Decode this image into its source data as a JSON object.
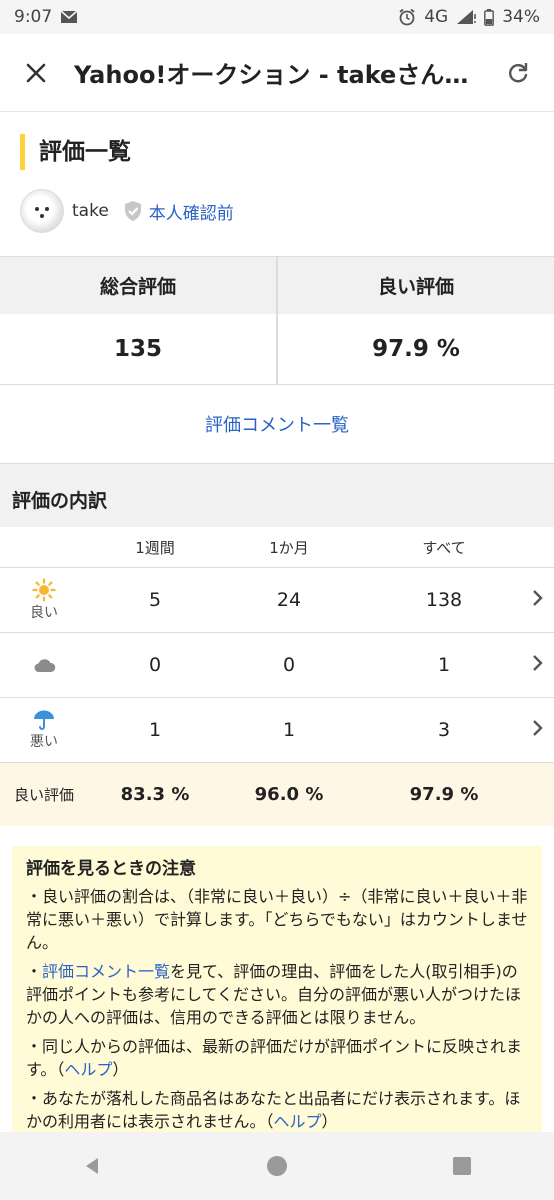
{
  "status": {
    "time": "9:07",
    "network": "4G",
    "battery": "34%"
  },
  "appbar": {
    "title": "Yahoo!オークション - takeさんの…"
  },
  "page": {
    "section_title": "評価一覧"
  },
  "user": {
    "name": "take",
    "verify_label": "本人確認前"
  },
  "summary": {
    "total_label": "総合評価",
    "total_value": "135",
    "good_label": "良い評価",
    "good_value": "97.9 %"
  },
  "comment_link": "評価コメント一覧",
  "breakdown": {
    "title": "評価の内訳",
    "headers": [
      "1週間",
      "1か月",
      "すべて"
    ],
    "rows": [
      {
        "label": "良い",
        "icon": "sun-icon",
        "values": [
          "5",
          "24",
          "138"
        ]
      },
      {
        "label": "",
        "icon": "cloud-icon",
        "values": [
          "0",
          "0",
          "1"
        ]
      },
      {
        "label": "悪い",
        "icon": "umbrella-icon",
        "values": [
          "1",
          "1",
          "3"
        ]
      }
    ],
    "rate_label": "良い評価",
    "rates": [
      "83.3 %",
      "96.0 %",
      "97.9 %"
    ]
  },
  "notes": {
    "title": "評価を見るときの注意",
    "n1": "・良い評価の割合は、（非常に良い＋良い）÷（非常に良い＋良い＋非常に悪い＋悪い）で計算します。「どちらでもない」はカウントしません。",
    "n2_prefix": "・",
    "n2_link": "評価コメント一覧",
    "n2_rest": "を見て、評価の理由、評価をした人(取引相手)の評価ポイントも参考にしてください。自分の評価が悪い人がつけたほかの人への評価は、信用のできる評価とは限りません。",
    "n3": "・同じ人からの評価は、最新の評価だけが評価ポイントに反映されます。（",
    "n3_link": "ヘルプ",
    "n3_end": "）",
    "n4": "・あなたが落札した商品名はあなたと出品者にだけ表示されます。ほかの利用者には表示されません。（",
    "n4_link": "ヘルプ",
    "n4_end": "）"
  },
  "colors": {
    "accent": "#ffd23c",
    "link": "#2a62c6",
    "sun": "#f7b731",
    "umbrella": "#3d8fdc"
  }
}
